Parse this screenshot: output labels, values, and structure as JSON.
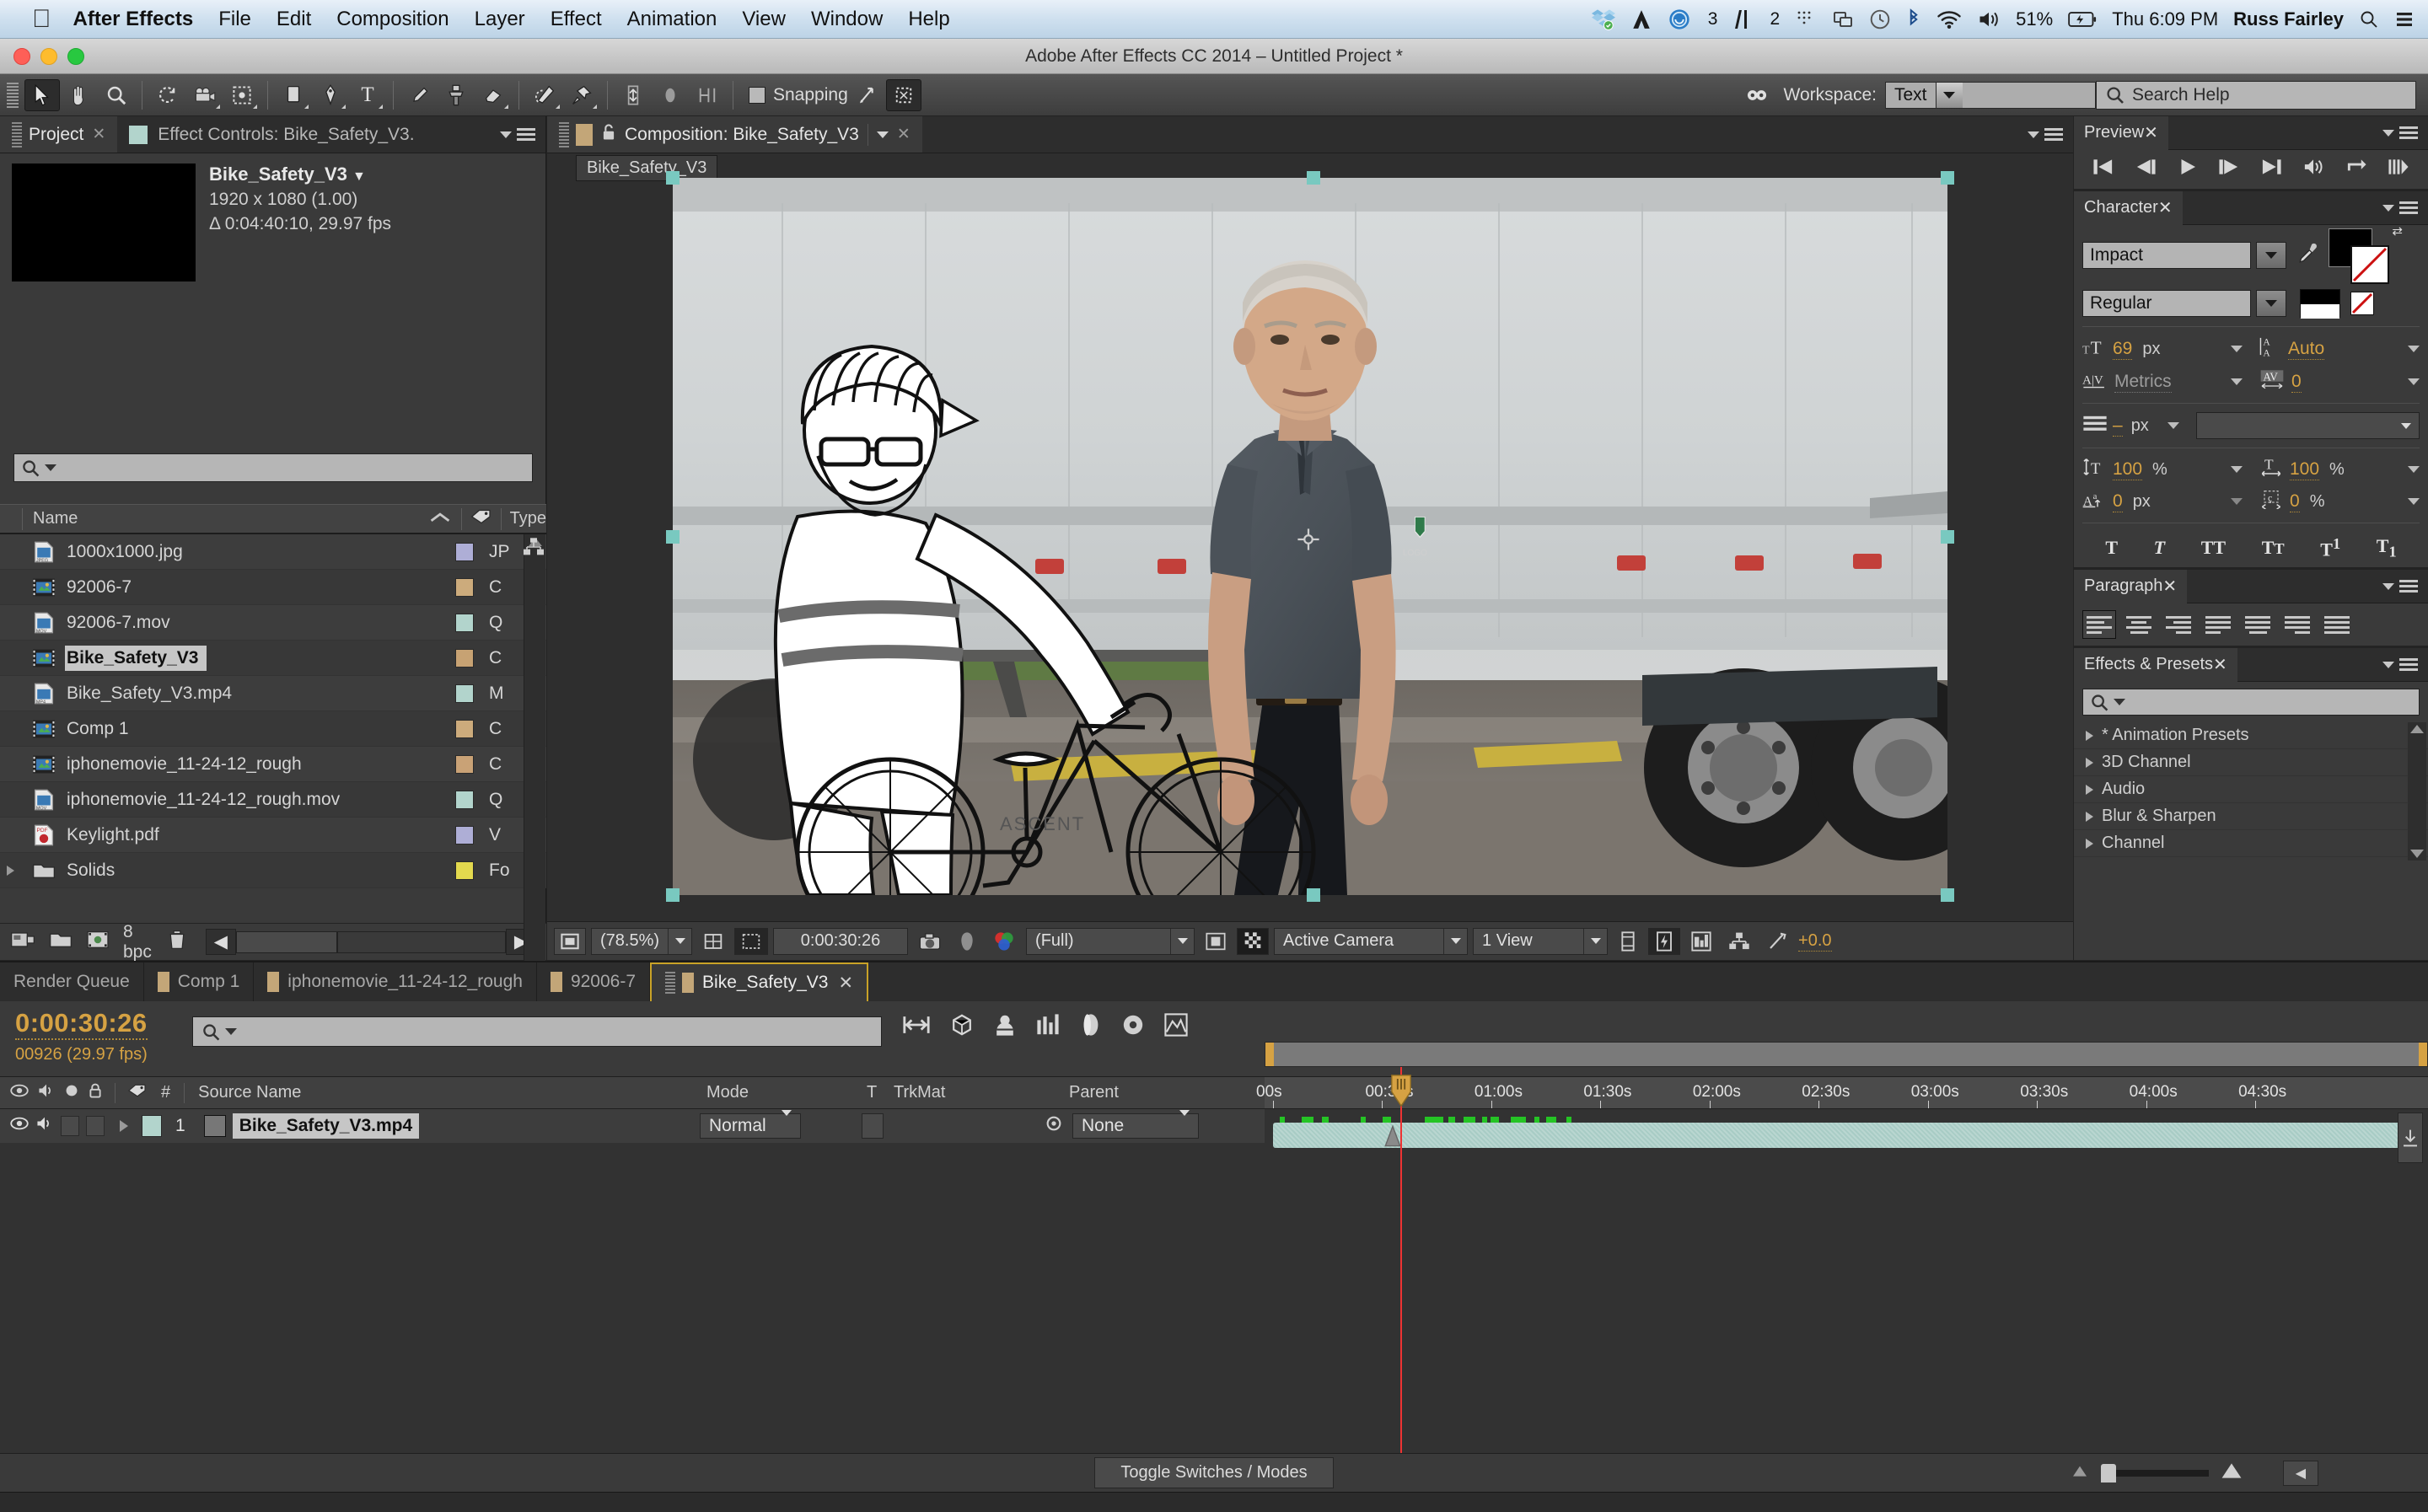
{
  "macbar": {
    "apple_icon": "apple-icon",
    "app_name": "After Effects",
    "menus": [
      "File",
      "Edit",
      "Composition",
      "Layer",
      "Effect",
      "Animation",
      "View",
      "Window",
      "Help"
    ],
    "status_icons": [
      "dropbox-icon",
      "adobe-cc-icon",
      "creative-cloud-icon",
      "illustrator-icon",
      "airplay-icon",
      "displays-icon",
      "timemachine-icon",
      "bluetooth-icon",
      "wifi-icon",
      "volume-icon",
      "battery-icon",
      "activity-icon",
      "spotlight-icon",
      "notification-center-icon"
    ],
    "cc_badge": "3",
    "ai_badge": "2",
    "battery_percent": "51%",
    "clock": "Thu 6:09 PM",
    "user": "Russ Fairley"
  },
  "titlebar": {
    "title": "Adobe After Effects CC 2014 – Untitled Project *"
  },
  "toolbar": {
    "tools": [
      {
        "name": "selection-tool",
        "glyph": "➤",
        "selected": true
      },
      {
        "name": "hand-tool",
        "glyph": "✋",
        "selected": false
      },
      {
        "name": "zoom-tool",
        "glyph": "🔍",
        "selected": false
      },
      {
        "name": "rotation-tool",
        "glyph": "↻",
        "selected": false
      },
      {
        "name": "camera-tool",
        "glyph": "🎥",
        "selected": false
      },
      {
        "name": "pan-behind-tool",
        "glyph": "⬚",
        "selected": false
      },
      {
        "name": "shape-tool",
        "glyph": "▭",
        "selected": false
      },
      {
        "name": "pen-tool",
        "glyph": "✒",
        "selected": false
      },
      {
        "name": "type-tool",
        "glyph": "T",
        "selected": false
      },
      {
        "name": "brush-tool",
        "glyph": "╱",
        "selected": false
      },
      {
        "name": "clone-stamp-tool",
        "glyph": "⚓",
        "selected": false
      },
      {
        "name": "eraser-tool",
        "glyph": "▱",
        "selected": false
      },
      {
        "name": "roto-brush-tool",
        "glyph": "⫽",
        "selected": false
      },
      {
        "name": "puppet-pin-tool",
        "glyph": "📌",
        "selected": false
      }
    ],
    "align_icons": [
      "anchor-align-icon",
      "ellipse-align-icon",
      "mask-align-icon"
    ],
    "snapping_label": "Snapping",
    "snapping_checked": false,
    "workspace_label": "Workspace:",
    "workspace_value": "Text",
    "search_help_placeholder": "Search Help"
  },
  "project": {
    "tabs": [
      {
        "label": "Project",
        "active": true,
        "closable": true
      },
      {
        "label": "Effect Controls: Bike_Safety_V3.",
        "active": false,
        "closable": false
      }
    ],
    "selected_item": {
      "name": "Bike_Safety_V3",
      "dimensions": "1920 x 1080 (1.00)",
      "duration": "Δ 0:04:40:10, 29.97 fps"
    },
    "search_placeholder": "",
    "columns": [
      "Name",
      "Type"
    ],
    "items": [
      {
        "name": "1000x1000.jpg",
        "icon": "jpeg-file-icon",
        "swatch": "#aeaed6",
        "type": "JP",
        "selected": false
      },
      {
        "name": "92006-7",
        "icon": "composition-icon",
        "swatch": "#ccab7c",
        "type": "C",
        "selected": false
      },
      {
        "name": "92006-7.mov",
        "icon": "mov-file-icon",
        "swatch": "#b2d4cc",
        "type": "Q",
        "selected": false
      },
      {
        "name": "Bike_Safety_V3",
        "icon": "composition-icon",
        "swatch": "#c7a273",
        "type": "C",
        "selected": true
      },
      {
        "name": "Bike_Safety_V3.mp4",
        "icon": "mpeg-file-icon",
        "swatch": "#b2d4cc",
        "type": "M",
        "selected": false
      },
      {
        "name": "Comp 1",
        "icon": "composition-icon",
        "swatch": "#ccab7c",
        "type": "C",
        "selected": false
      },
      {
        "name": "iphonemovie_11-24-12_rough",
        "icon": "composition-icon",
        "swatch": "#c9a276",
        "type": "C",
        "selected": false
      },
      {
        "name": "iphonemovie_11-24-12_rough.mov",
        "icon": "mov-file-icon",
        "swatch": "#b2d4cc",
        "type": "Q",
        "selected": false
      },
      {
        "name": "Keylight.pdf",
        "icon": "pdf-file-icon",
        "swatch": "#aeaed6",
        "type": "V",
        "selected": false
      },
      {
        "name": "Solids",
        "icon": "folder-icon",
        "swatch": "#e3d94e",
        "type": "Fo",
        "selected": false
      }
    ],
    "status": {
      "bit_depth": "8 bpc",
      "icons": [
        "new-comp-icon",
        "new-folder-icon",
        "project-settings-icon",
        "delete-icon"
      ]
    }
  },
  "composition": {
    "tab_label": "Composition: Bike_Safety_V3",
    "breadcrumb": "Bike_Safety_V3",
    "lock_icon": "unlock-icon",
    "swatch": "#c3a678",
    "toolbar": {
      "magnification": "(78.5%)",
      "timecode": "0:00:30:26",
      "resolution": "(Full)",
      "view": "Active Camera",
      "view_layout": "1 View",
      "exposure": "+0.0",
      "icons": [
        "show-channels-icon",
        "region-of-interest-icon",
        "mask-shape-icon",
        "snapshot-icon",
        "show-snapshot-icon",
        "show-channel-icon",
        "transparency-grid-icon",
        "title-safe-icon",
        "timeline-icon",
        "comp-flowchart-icon",
        "fast-previews-icon",
        "reset-exposure-icon"
      ]
    }
  },
  "preview": {
    "tab_label": "Preview",
    "buttons": [
      "first-frame-icon",
      "previous-frame-icon",
      "play-icon",
      "next-frame-icon",
      "last-frame-icon",
      "audio-icon",
      "loop-icon",
      "ram-preview-icon"
    ]
  },
  "character": {
    "tab_label": "Character",
    "font_family": "Impact",
    "font_style": "Regular",
    "font_size": "69",
    "font_size_unit": "px",
    "leading": "Auto",
    "kerning": "Metrics",
    "tracking": "0",
    "stroke_width": "–",
    "stroke_width_unit": "px",
    "stroke_type": "",
    "vertical_scale": "100",
    "horizontal_scale": "100",
    "baseline_shift": "0",
    "baseline_shift_unit": "px",
    "tsume": "0",
    "fill_color": "#000000",
    "stroke_color": "#ffffff",
    "style_buttons": [
      "faux-bold-icon",
      "faux-italic-icon",
      "all-caps-icon",
      "small-caps-icon",
      "superscript-icon",
      "subscript-icon"
    ],
    "eyedropper_icon": "eyedropper-icon"
  },
  "paragraph": {
    "tab_label": "Paragraph",
    "align_buttons": [
      "align-left-icon",
      "align-center-icon",
      "align-right-icon",
      "justify-last-left-icon",
      "justify-last-center-icon",
      "justify-last-right-icon",
      "justify-all-icon"
    ],
    "active_index": 0
  },
  "effects_presets": {
    "tab_label": "Effects & Presets",
    "search_placeholder": "",
    "categories": [
      "* Animation Presets",
      "3D Channel",
      "Audio",
      "Blur & Sharpen",
      "Channel"
    ]
  },
  "timeline": {
    "tabs": [
      {
        "label": "Render Queue",
        "active": false,
        "swatch": null
      },
      {
        "label": "Comp 1",
        "active": false,
        "swatch": "#c3a678"
      },
      {
        "label": "iphonemovie_11-24-12_rough",
        "active": false,
        "swatch": "#c3a678"
      },
      {
        "label": "92006-7",
        "active": false,
        "swatch": "#c3a678"
      },
      {
        "label": "Bike_Safety_V3",
        "active": true,
        "swatch": "#c3a678"
      }
    ],
    "current_time": "0:00:30:26",
    "frame_info": "00926 (29.97 fps)",
    "search_placeholder": "",
    "switch_icons": [
      "composition-mini-flowchart-icon",
      "draft-3d-icon",
      "hide-shy-layers-icon",
      "frame-blending-icon",
      "motion-blur-icon",
      "graph-editor-icon",
      "brainstorm-icon"
    ],
    "columns": [
      "#",
      "Source Name",
      "Mode",
      "T",
      "TrkMat",
      "Parent"
    ],
    "toggle_icons": [
      "video-eye-icon",
      "audio-speaker-icon",
      "solo-icon",
      "lock-icon",
      "label-icon"
    ],
    "layers": [
      {
        "index": "1",
        "source_name": "Bike_Safety_V3.mp4",
        "mode": "Normal",
        "trkmat": "",
        "parent": "None",
        "label_color": "#b2d4cc",
        "bar_color": "#a8ccc5",
        "icon": "mpeg-file-icon"
      }
    ],
    "ruler_labels": [
      "00s",
      "00:30s",
      "01:00s",
      "01:30s",
      "02:00s",
      "02:30s",
      "03:00s",
      "03:30s",
      "04:00s",
      "04:30s"
    ],
    "toggle_switches_label": "Toggle Switches / Modes",
    "playhead_time": "0:00:30:26"
  },
  "colors": {
    "accent_orange": "#d6a243",
    "panel_bg": "#3a3a3a",
    "dark_bg": "#2d2d2d",
    "playhead_red": "#ee3333",
    "layer_teal": "#a8ccc5"
  }
}
